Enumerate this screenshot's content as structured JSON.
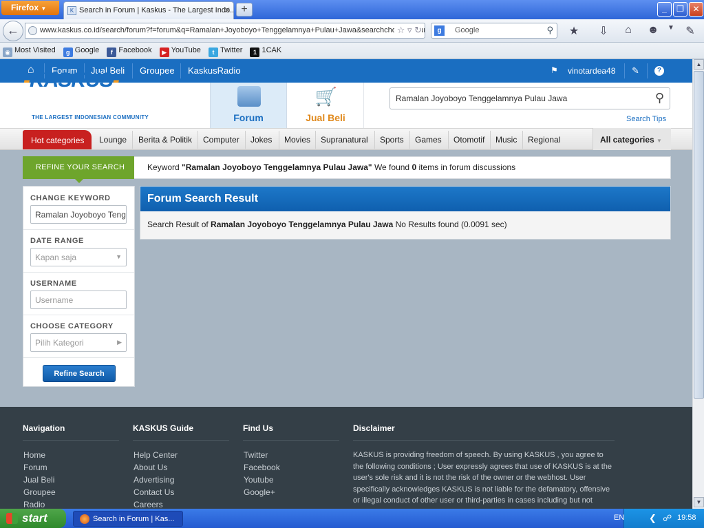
{
  "browser": {
    "menu_button": "Firefox",
    "tab_title": "Search in Forum | Kaskus - The Largest Indo...",
    "url": "www.kaskus.co.id/search/forum?f=forum&q=Ramalan+Joyoboyo+Tenggelamnya+Pulau+Jawa&searchchoice=forum",
    "search_engine_placeholder": "Google",
    "bookmarks": [
      "Most Visited",
      "Google",
      "Facebook",
      "YouTube",
      "Twitter",
      "1CAK"
    ]
  },
  "topnav": {
    "items": [
      "Forum",
      "Jual Beli",
      "Groupee",
      "KaskusRadio"
    ],
    "username": "vinotardea48"
  },
  "header": {
    "logo": "KASKUS",
    "tagline": "THE LARGEST INDONESIAN COMMUNITY",
    "forum_tab": "Forum",
    "jualbeli_tab": "Jual Beli",
    "search_value": "Ramalan Joyoboyo Tenggelamnya Pulau Jawa",
    "search_tips": "Search Tips"
  },
  "categories": {
    "hot": "Hot categories",
    "items": [
      "Lounge",
      "Berita & Politik",
      "Computer",
      "Jokes",
      "Movies",
      "Supranatural",
      "Sports",
      "Games",
      "Otomotif",
      "Music",
      "Regional"
    ],
    "all": "All categories"
  },
  "refine": {
    "tag": "REFINE YOUR SEARCH",
    "keyword_prefix": "Keyword ",
    "keyword": "\"Ramalan Joyoboyo Tenggelamnya Pulau Jawa\"",
    "found_prefix": " We found ",
    "count": "0",
    "found_suffix": " items in forum discussions"
  },
  "sidebar": {
    "change_keyword_label": "CHANGE KEYWORD",
    "keyword_value": "Ramalan Joyoboyo Tenggelamnya Pulau Jawa",
    "date_range_label": "DATE RANGE",
    "date_range_value": "Kapan saja",
    "username_label": "USERNAME",
    "username_placeholder": "Username",
    "category_label": "CHOOSE CATEGORY",
    "category_value": "Pilih Kategori",
    "refine_button": "Refine Search"
  },
  "result": {
    "title": "Forum Search Result",
    "prefix": "Search Result of ",
    "query": "Ramalan Joyoboyo Tenggelamnya Pulau Jawa",
    "suffix": " No Results found (0.0091 sec)"
  },
  "footer": {
    "navigation": {
      "title": "Navigation",
      "links": [
        "Home",
        "Forum",
        "Jual Beli",
        "Groupee",
        "Radio"
      ]
    },
    "guide": {
      "title": "KASKUS Guide",
      "links": [
        "Help Center",
        "About Us",
        "Advertising",
        "Contact Us",
        "Careers"
      ]
    },
    "findus": {
      "title": "Find Us",
      "links": [
        "Twitter",
        "Facebook",
        "Youtube",
        "Google+"
      ]
    },
    "disclaimer": {
      "title": "Disclaimer",
      "text": "KASKUS is providing freedom of speech. By using KASKUS , you agree to the following conditions ; User expressly agrees that use of KASKUS is at the user's sole risk and it is not the risk of the owner or the webhost. User specifically acknowledges KASKUS is not liable for the defamatory, offensive or illegal conduct of other user or third-parties in cases including but not limited"
    }
  },
  "taskbar": {
    "start": "start",
    "window": "Search in Forum | Kas...",
    "language": "EN",
    "time": "19:58"
  },
  "colors": {
    "kaskus_blue": "#1a6ec1",
    "hot_red": "#c8201f",
    "refine_green": "#6ea52c",
    "footer_bg": "#343f47"
  }
}
